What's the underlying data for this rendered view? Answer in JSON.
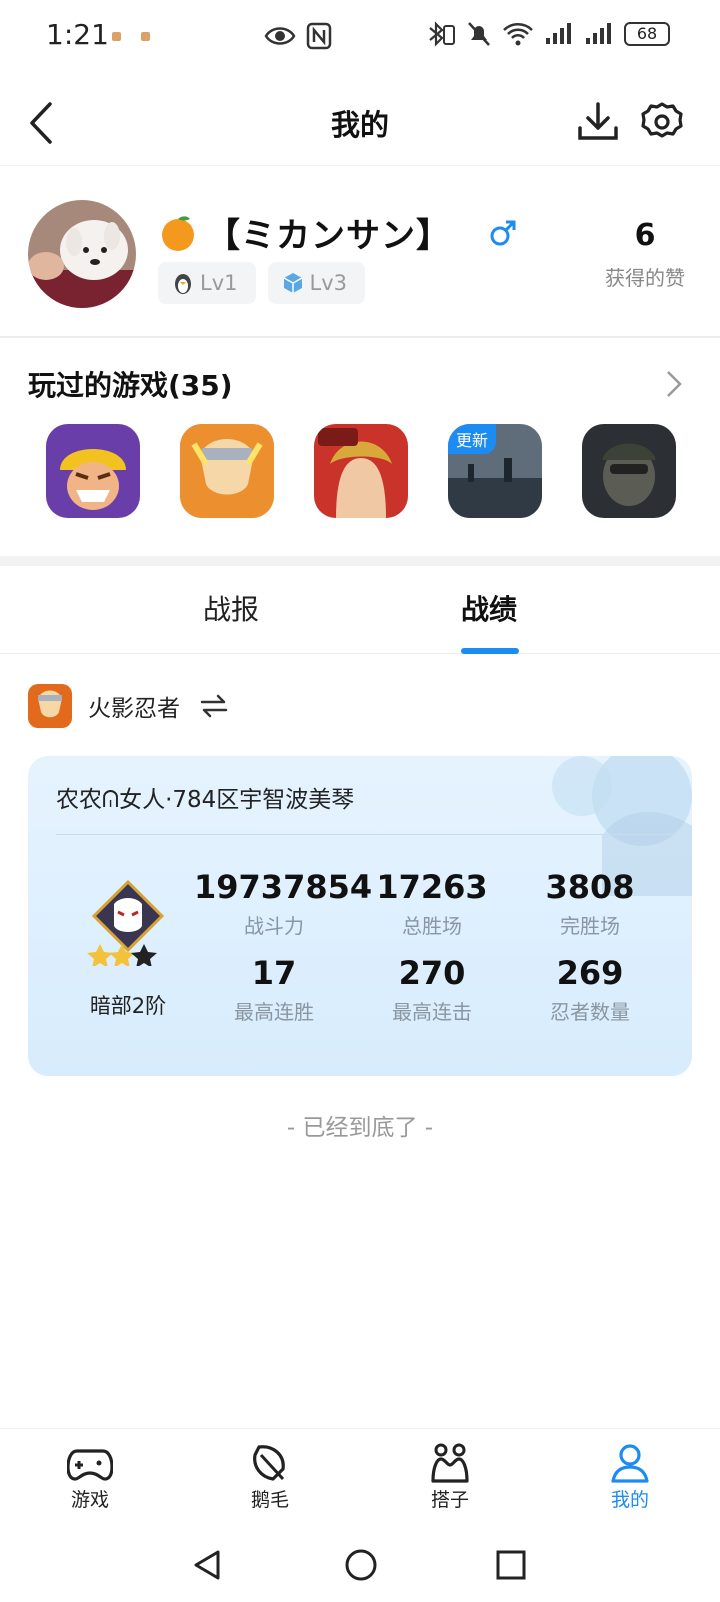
{
  "status_bar": {
    "time": "1:21",
    "battery": "68"
  },
  "nav": {
    "title": "我的"
  },
  "profile": {
    "nickname": "【ミカンサン】",
    "levels": [
      "Lv1",
      "Lv3"
    ],
    "likes_count": "6",
    "likes_label": "获得的赞"
  },
  "games": {
    "title": "玩过的游戏(35)",
    "update_badge": "更新"
  },
  "tabs": [
    "战报",
    "战绩"
  ],
  "selected_game": {
    "name": "火影忍者"
  },
  "record": {
    "server": "农农ᕬ女人·784区宇智波美琴",
    "rank": "暗部2阶",
    "stats": [
      {
        "value": "19737854",
        "label": "战斗力"
      },
      {
        "value": "17263",
        "label": "总胜场"
      },
      {
        "value": "3808",
        "label": "完胜场"
      },
      {
        "value": "17",
        "label": "最高连胜"
      },
      {
        "value": "270",
        "label": "最高连击"
      },
      {
        "value": "269",
        "label": "忍者数量"
      }
    ]
  },
  "end_text": "- 已经到底了 -",
  "bottom_nav": [
    "游戏",
    "鹅毛",
    "搭子",
    "我的"
  ],
  "colors": {
    "accent": "#1d8cf2",
    "card_bg": "#dcefff"
  }
}
